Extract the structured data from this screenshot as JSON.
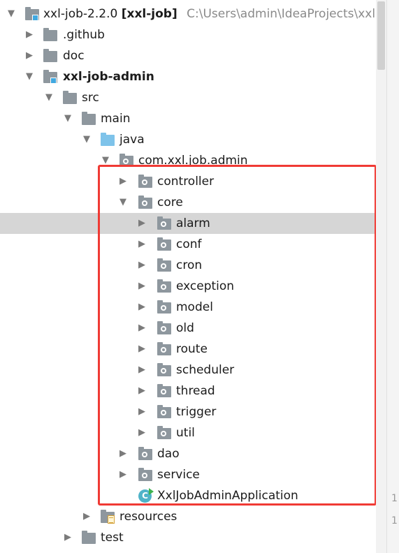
{
  "project": {
    "name": "xxl-job-2.2.0",
    "module_tag": "[xxl-job]",
    "path": "C:\\Users\\admin\\IdeaProjects\\xxl-jo"
  },
  "tree": {
    "github": ".github",
    "doc": "doc",
    "admin_module": "xxl-job-admin",
    "src": "src",
    "main": "main",
    "java": "java",
    "package": "com.xxl.job.admin",
    "controller": "controller",
    "core": "core",
    "core_children": [
      "alarm",
      "conf",
      "cron",
      "exception",
      "model",
      "old",
      "route",
      "scheduler",
      "thread",
      "trigger",
      "util"
    ],
    "dao": "dao",
    "service": "service",
    "app_class": "XxlJobAdminApplication",
    "class_glyph": "C",
    "resources": "resources",
    "test": "test"
  },
  "selected_item": "alarm",
  "gutter": {
    "line_numbers": [
      "1",
      "1"
    ]
  },
  "colors": {
    "highlight_border": "#f03a34",
    "selection": "#d6d6d6",
    "folder": "#8e979e",
    "source_folder": "#7ec3ea"
  },
  "icons": {
    "expanded": "arrow-down-icon",
    "collapsed": "arrow-right-icon",
    "folder": "folder-icon",
    "package": "package-icon",
    "class": "spring-class-icon"
  }
}
